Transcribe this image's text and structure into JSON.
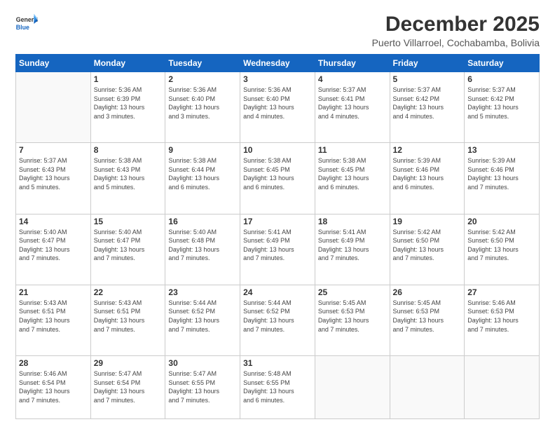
{
  "logo": {
    "line1": "General",
    "line2": "Blue"
  },
  "title": "December 2025",
  "location": "Puerto Villarroel, Cochabamba, Bolivia",
  "days_of_week": [
    "Sunday",
    "Monday",
    "Tuesday",
    "Wednesday",
    "Thursday",
    "Friday",
    "Saturday"
  ],
  "weeks": [
    [
      {
        "day": "",
        "info": ""
      },
      {
        "day": "1",
        "info": "Sunrise: 5:36 AM\nSunset: 6:39 PM\nDaylight: 13 hours\nand 3 minutes."
      },
      {
        "day": "2",
        "info": "Sunrise: 5:36 AM\nSunset: 6:40 PM\nDaylight: 13 hours\nand 3 minutes."
      },
      {
        "day": "3",
        "info": "Sunrise: 5:36 AM\nSunset: 6:40 PM\nDaylight: 13 hours\nand 4 minutes."
      },
      {
        "day": "4",
        "info": "Sunrise: 5:37 AM\nSunset: 6:41 PM\nDaylight: 13 hours\nand 4 minutes."
      },
      {
        "day": "5",
        "info": "Sunrise: 5:37 AM\nSunset: 6:42 PM\nDaylight: 13 hours\nand 4 minutes."
      },
      {
        "day": "6",
        "info": "Sunrise: 5:37 AM\nSunset: 6:42 PM\nDaylight: 13 hours\nand 5 minutes."
      }
    ],
    [
      {
        "day": "7",
        "info": "Sunrise: 5:37 AM\nSunset: 6:43 PM\nDaylight: 13 hours\nand 5 minutes."
      },
      {
        "day": "8",
        "info": "Sunrise: 5:38 AM\nSunset: 6:43 PM\nDaylight: 13 hours\nand 5 minutes."
      },
      {
        "day": "9",
        "info": "Sunrise: 5:38 AM\nSunset: 6:44 PM\nDaylight: 13 hours\nand 6 minutes."
      },
      {
        "day": "10",
        "info": "Sunrise: 5:38 AM\nSunset: 6:45 PM\nDaylight: 13 hours\nand 6 minutes."
      },
      {
        "day": "11",
        "info": "Sunrise: 5:38 AM\nSunset: 6:45 PM\nDaylight: 13 hours\nand 6 minutes."
      },
      {
        "day": "12",
        "info": "Sunrise: 5:39 AM\nSunset: 6:46 PM\nDaylight: 13 hours\nand 6 minutes."
      },
      {
        "day": "13",
        "info": "Sunrise: 5:39 AM\nSunset: 6:46 PM\nDaylight: 13 hours\nand 7 minutes."
      }
    ],
    [
      {
        "day": "14",
        "info": "Sunrise: 5:40 AM\nSunset: 6:47 PM\nDaylight: 13 hours\nand 7 minutes."
      },
      {
        "day": "15",
        "info": "Sunrise: 5:40 AM\nSunset: 6:47 PM\nDaylight: 13 hours\nand 7 minutes."
      },
      {
        "day": "16",
        "info": "Sunrise: 5:40 AM\nSunset: 6:48 PM\nDaylight: 13 hours\nand 7 minutes."
      },
      {
        "day": "17",
        "info": "Sunrise: 5:41 AM\nSunset: 6:49 PM\nDaylight: 13 hours\nand 7 minutes."
      },
      {
        "day": "18",
        "info": "Sunrise: 5:41 AM\nSunset: 6:49 PM\nDaylight: 13 hours\nand 7 minutes."
      },
      {
        "day": "19",
        "info": "Sunrise: 5:42 AM\nSunset: 6:50 PM\nDaylight: 13 hours\nand 7 minutes."
      },
      {
        "day": "20",
        "info": "Sunrise: 5:42 AM\nSunset: 6:50 PM\nDaylight: 13 hours\nand 7 minutes."
      }
    ],
    [
      {
        "day": "21",
        "info": "Sunrise: 5:43 AM\nSunset: 6:51 PM\nDaylight: 13 hours\nand 7 minutes."
      },
      {
        "day": "22",
        "info": "Sunrise: 5:43 AM\nSunset: 6:51 PM\nDaylight: 13 hours\nand 7 minutes."
      },
      {
        "day": "23",
        "info": "Sunrise: 5:44 AM\nSunset: 6:52 PM\nDaylight: 13 hours\nand 7 minutes."
      },
      {
        "day": "24",
        "info": "Sunrise: 5:44 AM\nSunset: 6:52 PM\nDaylight: 13 hours\nand 7 minutes."
      },
      {
        "day": "25",
        "info": "Sunrise: 5:45 AM\nSunset: 6:53 PM\nDaylight: 13 hours\nand 7 minutes."
      },
      {
        "day": "26",
        "info": "Sunrise: 5:45 AM\nSunset: 6:53 PM\nDaylight: 13 hours\nand 7 minutes."
      },
      {
        "day": "27",
        "info": "Sunrise: 5:46 AM\nSunset: 6:53 PM\nDaylight: 13 hours\nand 7 minutes."
      }
    ],
    [
      {
        "day": "28",
        "info": "Sunrise: 5:46 AM\nSunset: 6:54 PM\nDaylight: 13 hours\nand 7 minutes."
      },
      {
        "day": "29",
        "info": "Sunrise: 5:47 AM\nSunset: 6:54 PM\nDaylight: 13 hours\nand 7 minutes."
      },
      {
        "day": "30",
        "info": "Sunrise: 5:47 AM\nSunset: 6:55 PM\nDaylight: 13 hours\nand 7 minutes."
      },
      {
        "day": "31",
        "info": "Sunrise: 5:48 AM\nSunset: 6:55 PM\nDaylight: 13 hours\nand 6 minutes."
      },
      {
        "day": "",
        "info": ""
      },
      {
        "day": "",
        "info": ""
      },
      {
        "day": "",
        "info": ""
      }
    ]
  ]
}
